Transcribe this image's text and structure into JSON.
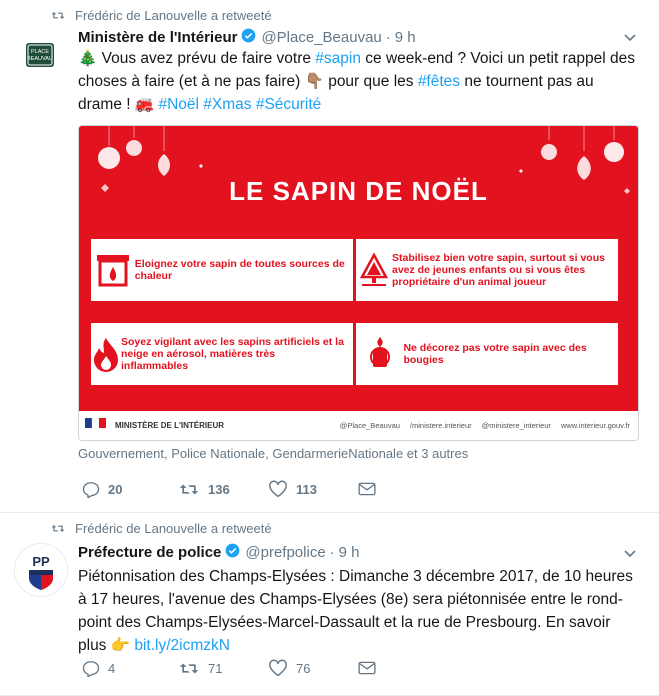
{
  "tweets": [
    {
      "retweet_label": "Frédéric de Lanouvelle a retweeté",
      "name": "Ministère de l'Intérieur",
      "handle": "@Place_Beauvau",
      "time": "9 h",
      "avatar_text": [
        "PLACE",
        "BEAUVAU"
      ],
      "text": {
        "p1": "🎄 Vous avez prévu de faire votre ",
        "l1": "#sapin",
        "p2": " ce week-end ? Voici un petit rappel des choses à faire (et à ne pas faire) 👇🏽 pour que les ",
        "l2": "#fêtes",
        "p3": " ne tournent pas au drame ! 🚒 ",
        "l3": "#Noël #Xmas #Sécurité"
      },
      "poster": {
        "title": "LE SAPIN DE NOËL",
        "cards": [
          "Eloignez votre sapin de toutes sources de chaleur",
          "Stabilisez bien votre sapin, surtout si vous avez de jeunes enfants ou si vous êtes propriétaire d'un animal joueur",
          "Soyez vigilant avec les sapins artificiels et la neige en aérosol, matières très inflammables",
          "Ne décorez pas votre sapin avec des bougies"
        ],
        "ministry": "MINISTÈRE DE L'INTÉRIEUR",
        "socials": [
          "@Place_Beauvau",
          "/ministere.interieur",
          "@ministere_interieur",
          "www.interieur.gouv.fr"
        ]
      },
      "tagged": "Gouvernement, Police Nationale, GendarmerieNationale et 3 autres",
      "replies": "20",
      "retweets": "136",
      "likes": "113"
    },
    {
      "retweet_label": "Frédéric de Lanouvelle a retweeté",
      "name": "Préfecture de police",
      "handle": "@prefpolice",
      "time": "9 h",
      "avatar_text": "PP",
      "text": {
        "p1": "Piétonnisation des Champs-Elysées : Dimanche 3 décembre 2017, de 10 heures à 17 heures, l'avenue des Champs-Elysées (8e) sera piétonnisée entre le rond-point des Champs-Elysées-Marcel-Dassault et la rue de Presbourg. En savoir plus 👉 ",
        "l1": "bit.ly/2icmzkN"
      },
      "replies": "4",
      "retweets": "71",
      "likes": "76"
    }
  ],
  "colors": {
    "accent": "#1da1f2",
    "poster_red": "#e2121f",
    "muted": "#657786"
  }
}
